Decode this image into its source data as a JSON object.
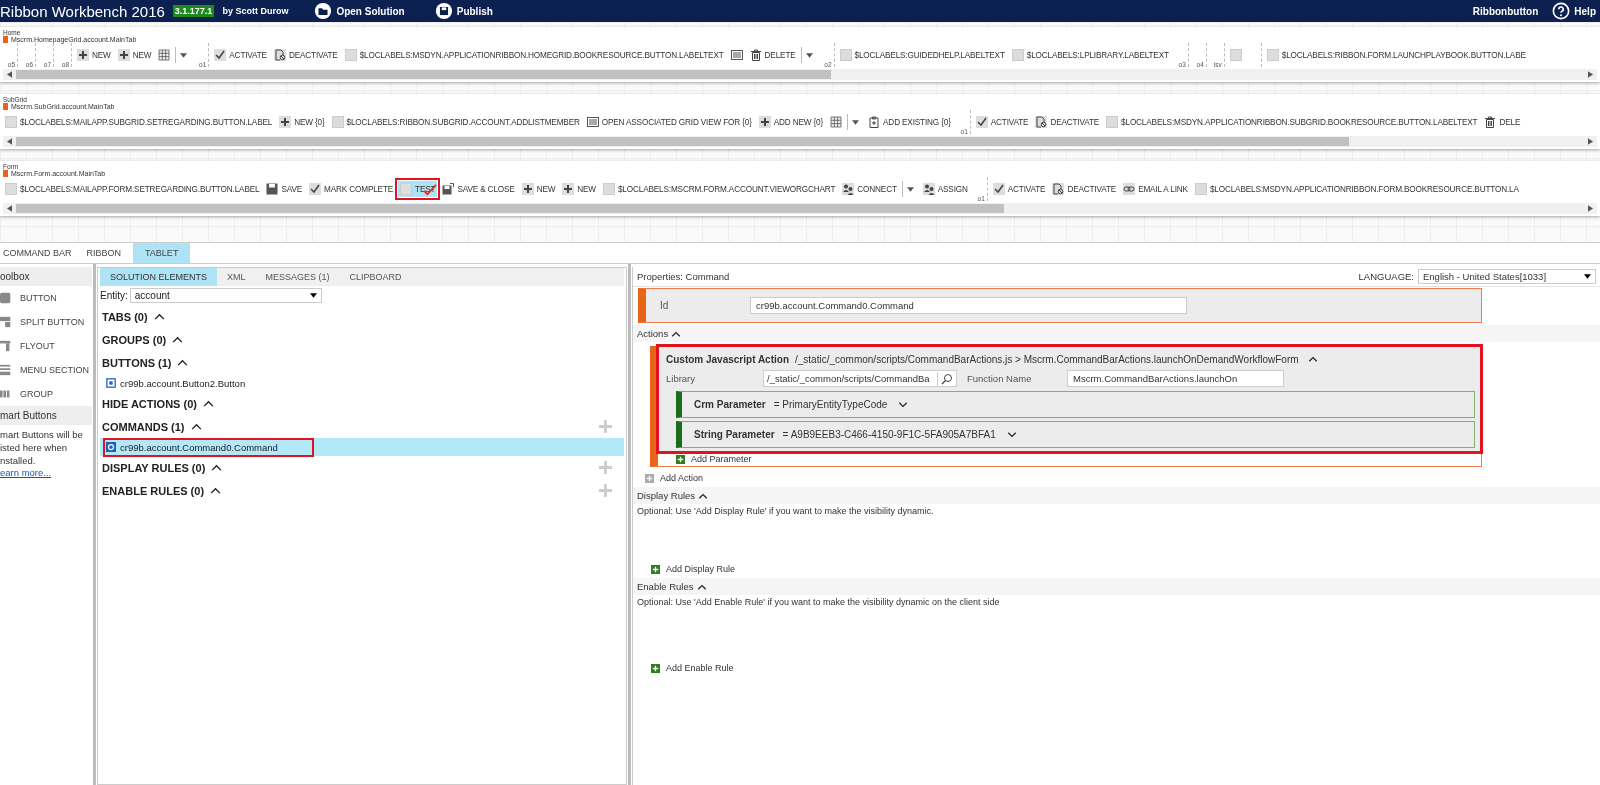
{
  "header": {
    "title": "Ribbon Workbench 2016",
    "version": "3.1.177.1",
    "author": "by Scott Durow",
    "actions": [
      {
        "label": "Open Solution"
      },
      {
        "label": "Publish"
      }
    ],
    "user": "Ribbonbutton",
    "help": "Help"
  },
  "ribbons": [
    {
      "title": "Home",
      "tab": "Mscrm.HomepageGrid.account.MainTab",
      "items": [
        {
          "kind": "marker",
          "label": "o5"
        },
        {
          "kind": "marker",
          "label": "o6"
        },
        {
          "kind": "marker",
          "label": "o7"
        },
        {
          "kind": "marker",
          "label": "o8"
        },
        {
          "kind": "plus",
          "label": "NEW",
          "selected": false,
          "annotated": false
        },
        {
          "kind": "plus",
          "label": "NEW",
          "selected": false,
          "annotated": false
        },
        {
          "kind": "grid",
          "selected": false,
          "annotated": false
        },
        {
          "kind": "caret"
        },
        {
          "kind": "marker",
          "label": "o1"
        },
        {
          "kind": "check",
          "label": "ACTIVATE",
          "selected": false,
          "annotated": false
        },
        {
          "kind": "deactivate",
          "label": "DEACTIVATE",
          "selected": false,
          "annotated": false
        },
        {
          "kind": "blank",
          "label": "$LOCLABELS:MSDYN.APPLICATIONRIBBON.HOMEGRID.BOOKRESOURCE.BUTTON.LABELTEXT",
          "selected": false,
          "annotated": false
        },
        {
          "kind": "form",
          "selected": false,
          "annotated": false
        },
        {
          "kind": "trash",
          "label": "DELETE",
          "selected": false,
          "annotated": false
        },
        {
          "kind": "caret"
        },
        {
          "kind": "marker",
          "label": "o2"
        },
        {
          "kind": "blank",
          "label": "$LOCLABELS:GUIDEDHELP.LABELTEXT",
          "selected": false,
          "annotated": false
        },
        {
          "kind": "blank",
          "label": "$LOCLABELS:LPLIBRARY.LABELTEXT",
          "selected": false,
          "annotated": false
        },
        {
          "kind": "marker",
          "label": "o3"
        },
        {
          "kind": "marker",
          "label": "o4"
        },
        {
          "kind": "marker",
          "label": "isv"
        },
        {
          "kind": "blank",
          "selected": false,
          "annotated": false
        },
        {
          "kind": "marker"
        },
        {
          "kind": "blank",
          "label": "$LOCLABELS:RIBBON.FORM.LAUNCHPLAYBOOK.BUTTON.LABE",
          "selected": false,
          "annotated": false
        }
      ]
    },
    {
      "title": "SubGrid",
      "tab": "Mscrm.SubGrid.account.MainTab",
      "items": [
        {
          "kind": "blank",
          "label": "$LOCLABELS:MAILAPP.SUBGRID.SETREGARDING.BUTTON.LABEL",
          "selected": false,
          "annotated": false
        },
        {
          "kind": "plus",
          "label": "NEW {0}",
          "selected": false,
          "annotated": false
        },
        {
          "kind": "blank",
          "label": "$LOCLABELS:RIBBON.SUBGRID.ACCOUNT.ADDLISTMEMBER",
          "selected": false,
          "annotated": false
        },
        {
          "kind": "form",
          "label": "OPEN ASSOCIATED GRID VIEW FOR {0}",
          "selected": false,
          "annotated": false
        },
        {
          "kind": "plus",
          "label": "ADD NEW {0}",
          "selected": false,
          "annotated": false
        },
        {
          "kind": "grid",
          "selected": false,
          "annotated": false
        },
        {
          "kind": "caret"
        },
        {
          "kind": "clipboard",
          "label": "ADD EXISTING {0}",
          "selected": false,
          "annotated": false
        },
        {
          "kind": "marker",
          "label": "o1"
        },
        {
          "kind": "check",
          "label": "ACTIVATE",
          "selected": false,
          "annotated": false
        },
        {
          "kind": "deactivate",
          "label": "DEACTIVATE",
          "selected": false,
          "annotated": false
        },
        {
          "kind": "blank",
          "label": "$LOCLABELS:MSDYN.APPLICATIONRIBBON.SUBGRID.BOOKRESOURCE.BUTTON.LABELTEXT",
          "selected": false,
          "annotated": false
        },
        {
          "kind": "trash",
          "label": "DELE",
          "selected": false,
          "annotated": false
        }
      ]
    },
    {
      "title": "Form",
      "tab": "Mscrm.Form.account.MainTab",
      "items": [
        {
          "kind": "blank",
          "label": "$LOCLABELS:MAILAPP.FORM.SETREGARDING.BUTTON.LABEL",
          "selected": false,
          "annotated": false
        },
        {
          "kind": "save",
          "label": "SAVE",
          "selected": false,
          "annotated": false
        },
        {
          "kind": "check",
          "label": "MARK COMPLETE",
          "selected": false,
          "annotated": false
        },
        {
          "kind": "blank",
          "label": "TEST",
          "selected": true,
          "annotated": true
        },
        {
          "kind": "saveclose",
          "label": "SAVE & CLOSE",
          "selected": false,
          "annotated": false
        },
        {
          "kind": "plus",
          "label": "NEW",
          "selected": false,
          "annotated": false
        },
        {
          "kind": "plus",
          "label": "NEW",
          "selected": false,
          "annotated": false
        },
        {
          "kind": "blank",
          "label": "$LOCLABELS:MSCRM.FORM.ACCOUNT.VIEWORGCHART",
          "selected": false,
          "annotated": false
        },
        {
          "kind": "people",
          "label": "CONNECT",
          "selected": false,
          "annotated": false
        },
        {
          "kind": "caret"
        },
        {
          "kind": "people",
          "label": "ASSIGN",
          "selected": false,
          "annotated": false
        },
        {
          "kind": "marker",
          "label": "o1"
        },
        {
          "kind": "check",
          "label": "ACTIVATE",
          "selected": false,
          "annotated": false
        },
        {
          "kind": "deactivate",
          "label": "DEACTIVATE",
          "selected": false,
          "annotated": false
        },
        {
          "kind": "link",
          "label": "EMAIL A LINK",
          "selected": false,
          "annotated": false
        },
        {
          "kind": "blank",
          "label": "$LOCLABELS:MSDYN.APPLICATIONRIBBON.FORM.BOOKRESOURCE.BUTTON.LA",
          "selected": false,
          "annotated": false
        }
      ]
    }
  ],
  "view_tabs": [
    {
      "label": "COMMAND BAR",
      "selected": false
    },
    {
      "label": "RIBBON",
      "selected": false
    },
    {
      "label": "TABLET",
      "selected": true
    }
  ],
  "toolbox": {
    "title": "oolbox",
    "items": [
      {
        "kind": "button",
        "label": "BUTTON"
      },
      {
        "kind": "split",
        "label": "SPLIT BUTTON"
      },
      {
        "kind": "flyout",
        "label": "FLYOUT"
      },
      {
        "kind": "menu",
        "label": "MENU SECTION"
      },
      {
        "kind": "group",
        "label": "GROUP"
      }
    ],
    "smart_title": "mart Buttons",
    "smart_text": "mart Buttons will be isted here when nstalled.",
    "smart_link": "earn more..."
  },
  "solution": {
    "tabs": [
      {
        "label": "SOLUTION ELEMENTS",
        "selected": true
      },
      {
        "label": "XML",
        "selected": false
      },
      {
        "label": "MESSAGES (1)",
        "selected": false
      },
      {
        "label": "CLIPBOARD",
        "selected": false
      }
    ],
    "entity_label": "Entity:",
    "entity": "account",
    "sections": [
      {
        "label": "TABS (0)",
        "expanded": true,
        "addable": false
      },
      {
        "label": "GROUPS (0)",
        "expanded": true,
        "addable": false
      },
      {
        "label": "BUTTONS (1)",
        "expanded": true,
        "addable": false,
        "items": [
          {
            "kind": "button",
            "label": "cr99b.account.Button2.Button",
            "selected": false,
            "annotated": false
          }
        ]
      },
      {
        "label": "HIDE ACTIONS (0)",
        "expanded": true,
        "addable": false
      },
      {
        "label": "COMMANDS (1)",
        "expanded": true,
        "addable": true,
        "items": [
          {
            "kind": "command",
            "label": "cr99b.account.Command0.Command",
            "selected": true,
            "annotated": true
          }
        ]
      },
      {
        "label": "DISPLAY RULES (0)",
        "expanded": true,
        "addable": true
      },
      {
        "label": "ENABLE RULES (0)",
        "expanded": true,
        "addable": true
      }
    ]
  },
  "properties": {
    "title": "Properties: Command",
    "language_label": "LANGUAGE:",
    "language": "English - United States[1033]",
    "id_label": "Id",
    "id": "cr99b.account.Command0.Command",
    "actions_label": "Actions",
    "actions_expanded": true,
    "actions": [
      {
        "title": "Custom Javascript Action",
        "summary": "/_static/_common/scripts/CommandBarActions.js > Mscrm.CommandBarActions.launchOnDemandWorkflowForm",
        "expanded": true,
        "annotated": true,
        "library_label": "Library",
        "library": "/_static/_common/scripts/CommandBa",
        "function_label": "Function Name",
        "function": "Mscrm.CommandBarActions.launchOn",
        "parameters": [
          {
            "name": "Crm Parameter",
            "value": "= PrimaryEntityTypeCode",
            "expanded": false
          },
          {
            "name": "String Parameter",
            "value": "= A9B9EEB3-C466-4150-9F1C-5FA905A7BFA1",
            "expanded": false
          }
        ],
        "add_parameter": "Add Parameter"
      }
    ],
    "add_action": "Add Action",
    "rules": [
      {
        "title": "Display Rules",
        "expanded": true,
        "hint": "Optional: Use 'Add Display Rule' if you want to make the visibility dynamic.",
        "add": "Add Display Rule"
      },
      {
        "title": "Enable Rules",
        "expanded": true,
        "hint": "Optional: Use 'Add Enable Rule' if you want to make the visibility dynamic on the client side",
        "add": "Add Enable Rule"
      }
    ]
  }
}
